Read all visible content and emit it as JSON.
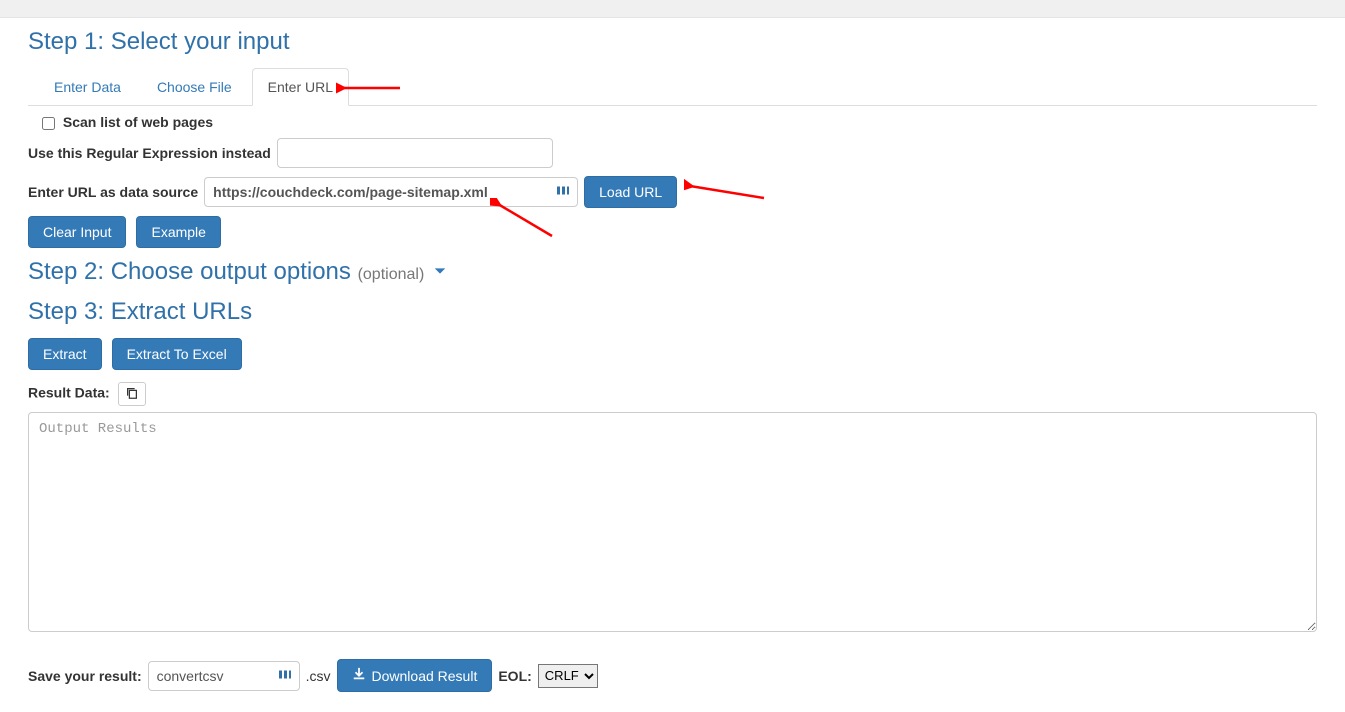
{
  "step1": {
    "heading": "Step 1: Select your input",
    "tabs": [
      "Enter Data",
      "Choose File",
      "Enter URL"
    ],
    "scan_label": "Scan list of web pages",
    "regex_label": "Use this Regular Expression instead",
    "regex_value": "",
    "url_label": "Enter URL as data source",
    "url_value": "https://couchdeck.com/page-sitemap.xml",
    "load_url_label": "Load URL",
    "clear_input_label": "Clear Input",
    "example_label": "Example"
  },
  "step2": {
    "heading": "Step 2: Choose output options",
    "optional": "(optional)"
  },
  "step3": {
    "heading": "Step 3: Extract URLs",
    "extract_label": "Extract",
    "extract_excel_label": "Extract To Excel",
    "result_label": "Result Data:",
    "output_placeholder": "Output Results"
  },
  "save": {
    "label": "Save your result:",
    "filename": "convertcsv",
    "ext": ".csv",
    "download_label": "Download Result",
    "eol_label": "EOL:",
    "eol_value": "CRLF"
  }
}
